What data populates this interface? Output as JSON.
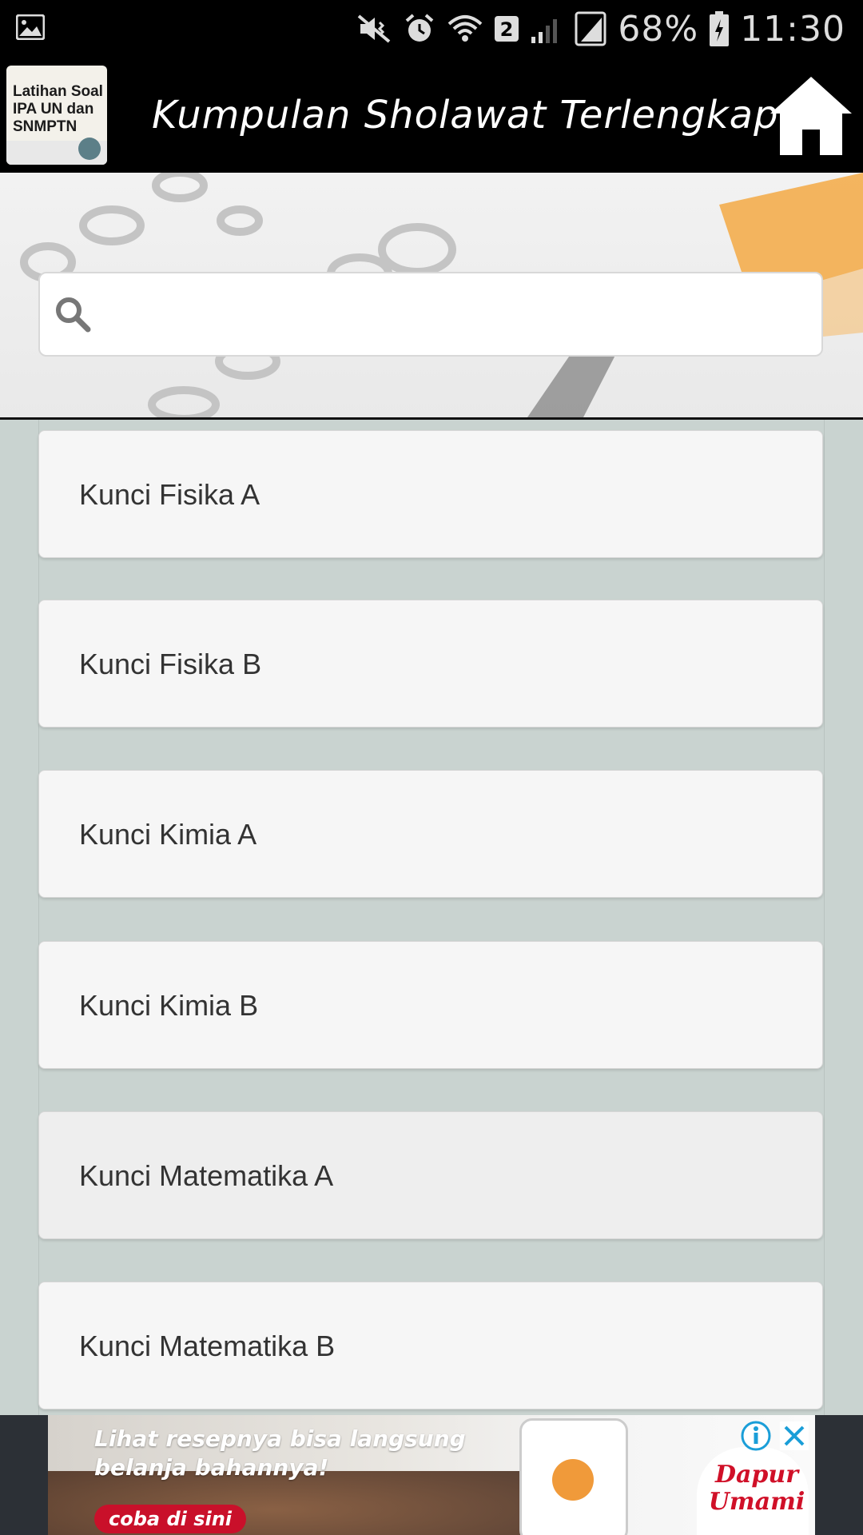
{
  "status_bar": {
    "battery": "68%",
    "time": "11:30",
    "notification_count": "2",
    "icons": [
      "gallery-icon",
      "mute-vibrate-icon",
      "alarm-icon",
      "wifi-icon",
      "signal-icon",
      "sim-icon",
      "battery-charging-icon"
    ]
  },
  "app_bar": {
    "logo_text": "Latihan Soal\nIPA UN dan\nSNMPTN",
    "title": "Kumpulan Sholawat Terlengkap",
    "home_icon": "home-icon"
  },
  "search": {
    "placeholder": "",
    "value": "",
    "icon": "search-icon"
  },
  "list": {
    "items": [
      {
        "label": "Kunci Fisika A"
      },
      {
        "label": "Kunci Fisika B"
      },
      {
        "label": "Kunci Kimia A"
      },
      {
        "label": "Kunci Kimia B"
      },
      {
        "label": "Kunci Matematika A"
      },
      {
        "label": "Kunci Matematika B"
      }
    ]
  },
  "ad": {
    "headline": "Lihat resepnya bisa langsung belanja bahannya!",
    "cta": "coba di sini",
    "brand": "Dapur Umami",
    "icons": [
      "info-icon",
      "close-icon"
    ]
  },
  "colors": {
    "bar_bg": "#000000",
    "list_bg": "#c9d3d0",
    "item_bg": "#f6f6f6",
    "ad_cta": "#c9102a"
  }
}
